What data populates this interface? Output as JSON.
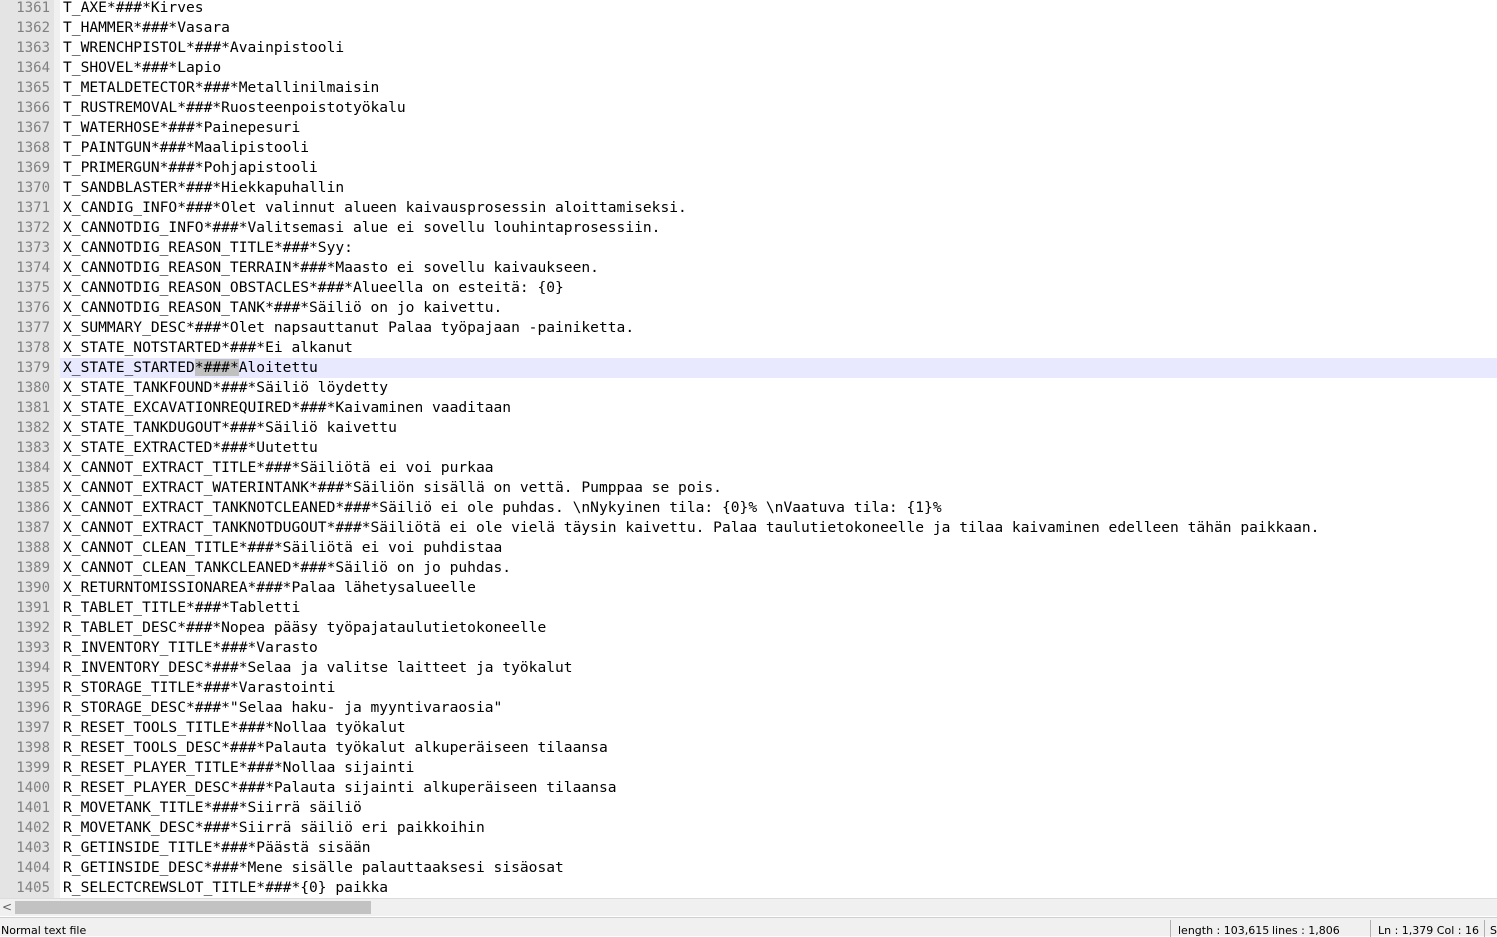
{
  "editor": {
    "current_line_number": "1379",
    "current_highlight": "*###*",
    "lines": [
      {
        "num": "1361",
        "text": "T_AXE*###*Kirves"
      },
      {
        "num": "1362",
        "text": "T_HAMMER*###*Vasara"
      },
      {
        "num": "1363",
        "text": "T_WRENCHPISTOL*###*Avainpistooli"
      },
      {
        "num": "1364",
        "text": "T_SHOVEL*###*Lapio"
      },
      {
        "num": "1365",
        "text": "T_METALDETECTOR*###*Metallinilmaisin"
      },
      {
        "num": "1366",
        "text": "T_RUSTREMOVAL*###*Ruosteenpoistotyökalu"
      },
      {
        "num": "1367",
        "text": "T_WATERHOSE*###*Painepesuri"
      },
      {
        "num": "1368",
        "text": "T_PAINTGUN*###*Maalipistooli"
      },
      {
        "num": "1369",
        "text": "T_PRIMERGUN*###*Pohjapistooli"
      },
      {
        "num": "1370",
        "text": "T_SANDBLASTER*###*Hiekkapuhallin"
      },
      {
        "num": "1371",
        "text": "X_CANDIG_INFO*###*Olet valinnut alueen kaivausprosessin aloittamiseksi."
      },
      {
        "num": "1372",
        "text": "X_CANNOTDIG_INFO*###*Valitsemasi alue ei sovellu louhintaprosessiin."
      },
      {
        "num": "1373",
        "text": "X_CANNOTDIG_REASON_TITLE*###*Syy:"
      },
      {
        "num": "1374",
        "text": "X_CANNOTDIG_REASON_TERRAIN*###*Maasto ei sovellu kaivaukseen."
      },
      {
        "num": "1375",
        "text": "X_CANNOTDIG_REASON_OBSTACLES*###*Alueella on esteitä: {0}"
      },
      {
        "num": "1376",
        "text": "X_CANNOTDIG_REASON_TANK*###*Säiliö on jo kaivettu."
      },
      {
        "num": "1377",
        "text": "X_SUMMARY_DESC*###*Olet napsauttanut Palaa työpajaan -painiketta."
      },
      {
        "num": "1378",
        "text": "X_STATE_NOTSTARTED*###*Ei alkanut"
      },
      {
        "num": "1379",
        "text": "X_STATE_STARTED*###*Aloitettu"
      },
      {
        "num": "1380",
        "text": "X_STATE_TANKFOUND*###*Säiliö löydetty"
      },
      {
        "num": "1381",
        "text": "X_STATE_EXCAVATIONREQUIRED*###*Kaivaminen vaaditaan"
      },
      {
        "num": "1382",
        "text": "X_STATE_TANKDUGOUT*###*Säiliö kaivettu"
      },
      {
        "num": "1383",
        "text": "X_STATE_EXTRACTED*###*Uutettu"
      },
      {
        "num": "1384",
        "text": "X_CANNOT_EXTRACT_TITLE*###*Säiliötä ei voi purkaa"
      },
      {
        "num": "1385",
        "text": "X_CANNOT_EXTRACT_WATERINTANK*###*Säiliön sisällä on vettä. Pumppaa se pois."
      },
      {
        "num": "1386",
        "text": "X_CANNOT_EXTRACT_TANKNOTCLEANED*###*Säiliö ei ole puhdas. \\nNykyinen tila: {0}% \\nVaatuva tila: {1}%"
      },
      {
        "num": "1387",
        "text": "X_CANNOT_EXTRACT_TANKNOTDUGOUT*###*Säiliötä ei ole vielä täysin kaivettu. Palaa taulutietokoneelle ja tilaa kaivaminen edelleen tähän paikkaan."
      },
      {
        "num": "1388",
        "text": "X_CANNOT_CLEAN_TITLE*###*Säiliötä ei voi puhdistaa"
      },
      {
        "num": "1389",
        "text": "X_CANNOT_CLEAN_TANKCLEANED*###*Säiliö on jo puhdas."
      },
      {
        "num": "1390",
        "text": "X_RETURNTOMISSIONAREA*###*Palaa lähetysalueelle"
      },
      {
        "num": "1391",
        "text": "R_TABLET_TITLE*###*Tabletti"
      },
      {
        "num": "1392",
        "text": "R_TABLET_DESC*###*Nopea pääsy työpajataulutietokoneelle"
      },
      {
        "num": "1393",
        "text": "R_INVENTORY_TITLE*###*Varasto"
      },
      {
        "num": "1394",
        "text": "R_INVENTORY_DESC*###*Selaa ja valitse laitteet ja työkalut"
      },
      {
        "num": "1395",
        "text": "R_STORAGE_TITLE*###*Varastointi"
      },
      {
        "num": "1396",
        "text": "R_STORAGE_DESC*###*\"Selaa haku- ja myyntivaraosia\""
      },
      {
        "num": "1397",
        "text": "R_RESET_TOOLS_TITLE*###*Nollaa työkalut"
      },
      {
        "num": "1398",
        "text": "R_RESET_TOOLS_DESC*###*Palauta työkalut alkuperäiseen tilaansa"
      },
      {
        "num": "1399",
        "text": "R_RESET_PLAYER_TITLE*###*Nollaa sijainti"
      },
      {
        "num": "1400",
        "text": "R_RESET_PLAYER_DESC*###*Palauta sijainti alkuperäiseen tilaansa"
      },
      {
        "num": "1401",
        "text": "R_MOVETANK_TITLE*###*Siirrä säiliö"
      },
      {
        "num": "1402",
        "text": "R_MOVETANK_DESC*###*Siirrä säiliö eri paikkoihin"
      },
      {
        "num": "1403",
        "text": "R_GETINSIDE_TITLE*###*Päästä sisään"
      },
      {
        "num": "1404",
        "text": "R_GETINSIDE_DESC*###*Mene sisälle palauttaaksesi sisäosat"
      },
      {
        "num": "1405",
        "text": "R_SELECTCREWSLOT_TITLE*###*{0} paikka"
      }
    ]
  },
  "scrollbar": {
    "left_arrow_icon": "chevron-left-icon",
    "left_arrow_glyph": "<"
  },
  "status": {
    "file_type": "Normal text file",
    "length": "length : 103,615",
    "lines": "lines : 1,806",
    "position": "Ln : 1,379    Col : 16",
    "sel": "S"
  }
}
